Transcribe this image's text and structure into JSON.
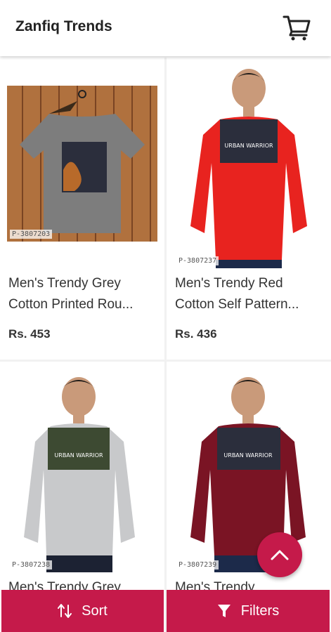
{
  "header": {
    "title": "Zanfiq Trends",
    "cart_icon": "cart-icon"
  },
  "products": [
    {
      "name_line1": "Men's Trendy Grey",
      "name_line2": "Cotton Printed Rou...",
      "price": "Rs. 453",
      "code": "P-3807203",
      "shirt_color": "#7d7d7d"
    },
    {
      "name_line1": "Men's Trendy Red",
      "name_line2": "Cotton Self Pattern...",
      "price": "Rs. 436",
      "code": "P-3807237",
      "shirt_color": "#e8231f"
    },
    {
      "name_line1": "Men's Trendy Grey",
      "name_line2": "",
      "price": "",
      "code": "P-3807238",
      "shirt_color": "#c8c9cb"
    },
    {
      "name_line1": "Men's Trendy",
      "name_line2": "",
      "price": "",
      "code": "P-3807239",
      "shirt_color": "#7a1424"
    }
  ],
  "shirt_print_text": "URBAN WARRIOR",
  "bottom_bar": {
    "sort_label": "Sort",
    "filters_label": "Filters",
    "sort_icon": "sort-icon",
    "filter_icon": "filter-icon"
  },
  "fab_icon": "chevron-up-icon",
  "colors": {
    "accent": "#c51a4a"
  }
}
